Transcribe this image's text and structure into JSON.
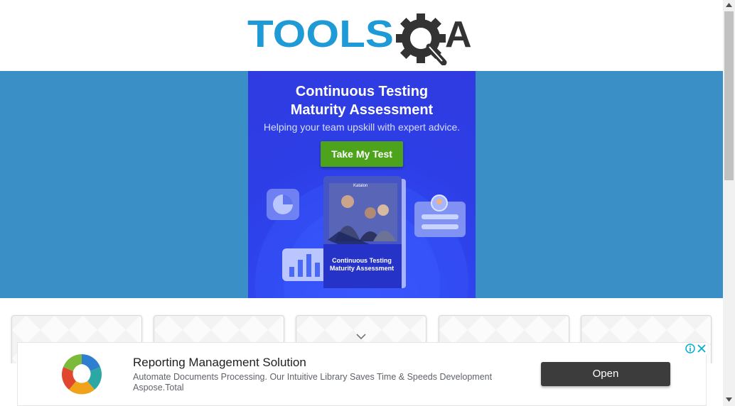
{
  "header": {
    "logo_text_blue": "TOOLS",
    "logo_text_dark": "A",
    "logo_icon": "gear-magnifier-q-icon"
  },
  "banner_ad": {
    "title_line_1": "Continuous Testing",
    "title_line_2": "Maturity Assessment",
    "subtitle": "Helping your team upskill with expert advice.",
    "cta_label": "Take My Test",
    "brand_mark": "Katalon",
    "cover_title_line_1": "Continuous Testing",
    "cover_title_line_2": "Maturity Assessment",
    "icons": [
      "pie-chart-icon",
      "bar-chart-icon",
      "profile-card-icon"
    ]
  },
  "cards": {
    "count": 5,
    "chevron_icon": "chevron-down-icon"
  },
  "bottom_ad": {
    "title": "Reporting Management Solution",
    "description": "Automate Documents Processing. Our Intuitive Library Saves Time & Speeds Development",
    "brand": "Aspose.Total",
    "button_label": "Open",
    "choices_icons": [
      "info-icon",
      "close-icon"
    ]
  },
  "colors": {
    "logo_blue": "#1e9ad6",
    "logo_dark": "#333333",
    "banner_background": "#3a8fc7",
    "ad_background": "#2f3be0",
    "cta_green": "#4ea31d",
    "open_button": "#3c3c3c",
    "ad_choices_blue": "#00aecd"
  }
}
